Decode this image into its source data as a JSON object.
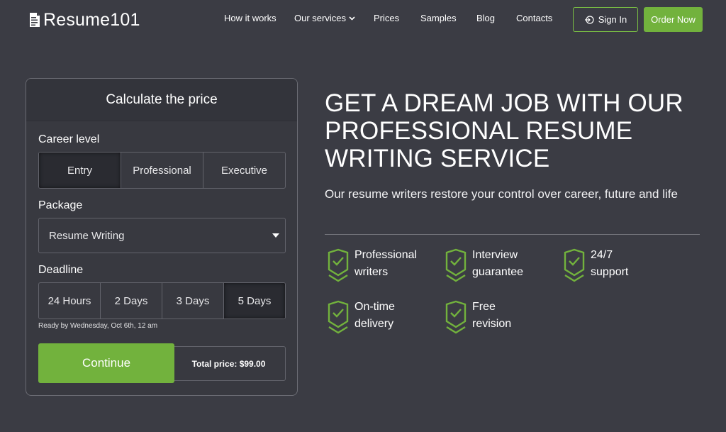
{
  "header": {
    "logo_text": "Resume101",
    "nav": [
      {
        "label": "How it works"
      },
      {
        "label": "Our services"
      },
      {
        "label": "Prices"
      },
      {
        "label": "Samples"
      },
      {
        "label": "Blog"
      },
      {
        "label": "Contacts"
      }
    ],
    "signin_label": "Sign In",
    "order_label": "Order Now"
  },
  "calculator": {
    "title": "Calculate the price",
    "career_label": "Career level",
    "career_options": [
      "Entry",
      "Professional",
      "Executive"
    ],
    "career_selected": "Entry",
    "package_label": "Package",
    "package_value": "Resume Writing",
    "deadline_label": "Deadline",
    "deadline_options": [
      "24 Hours",
      "2 Days",
      "3 Days",
      "5 Days"
    ],
    "deadline_selected": "5 Days",
    "ready_text": "Ready by Wednesday, Oct 6th, 12 am",
    "continue_label": "Continue",
    "total_text": "Total price: $99.00"
  },
  "hero": {
    "title": "GET A DREAM JOB WITH OUR PROFESSIONAL RESUME WRITING SERVICE",
    "subtitle": "Our resume writers restore your control over career, future and life",
    "features": [
      {
        "line1": "Professional",
        "line2": "writers"
      },
      {
        "line1": "Interview",
        "line2": "guarantee"
      },
      {
        "line1": "24/7",
        "line2": "support"
      },
      {
        "line1": "On-time",
        "line2": "delivery"
      },
      {
        "line1": "Free",
        "line2": "revision"
      }
    ]
  },
  "colors": {
    "background": "#3b3c44",
    "accent": "#72b23d",
    "panel": "#383940"
  },
  "icons": {
    "logo": "document-logo-icon",
    "signin": "sign-in-icon",
    "dropdown": "chevron-down-icon",
    "feature": "shield-check-icon"
  }
}
